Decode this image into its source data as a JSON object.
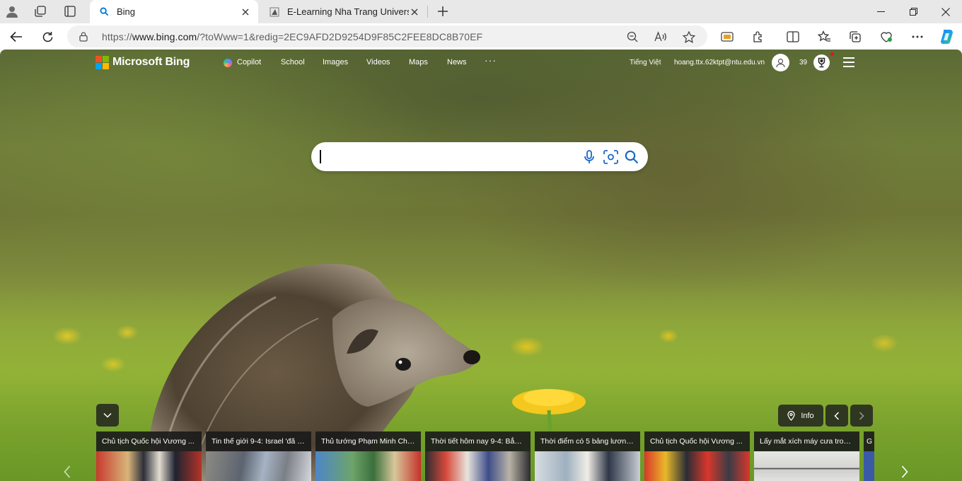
{
  "browser": {
    "tabs": [
      {
        "title": "Bing",
        "active": true,
        "icon": "bing-search-icon"
      },
      {
        "title": "E-Learning Nha Trang University",
        "active": false,
        "icon": "page-favicon"
      }
    ],
    "address": {
      "url_prefix": "https://",
      "url_host": "www.bing.com",
      "url_path": "/?toWww=1&redig=2EC9AFD2D9254D9F85C2FEE8DC8B70EF"
    }
  },
  "bing": {
    "brand": "Microsoft Bing",
    "nav": [
      "Copilot",
      "School",
      "Images",
      "Videos",
      "Maps",
      "News"
    ],
    "more": "···",
    "language": "Tiếng Việt",
    "user_email": "hoang.ttx.62ktpt@ntu.edu.vn",
    "reward_points": "39",
    "search": {
      "value": "",
      "placeholder": ""
    },
    "info_label": "Info",
    "headlines": [
      "Chủ tịch Quốc hội Vương ...",
      "Tin thế giới 9-4: Israel 'đã c...",
      "Thủ tướng Phạm Minh Chí...",
      "Thời tiết hôm nay 9-4: Bắc ...",
      "Thời điểm có 5 bảng lương...",
      "Chủ tịch Quốc hội Vương ...",
      "Lấy mắt xích máy cưa tron...",
      "G"
    ]
  },
  "colors": {
    "ms_red": "#f25022",
    "ms_green": "#7fba00",
    "ms_blue": "#00a4ef",
    "ms_yellow": "#ffb900",
    "edge_accent": "#0078d4"
  }
}
